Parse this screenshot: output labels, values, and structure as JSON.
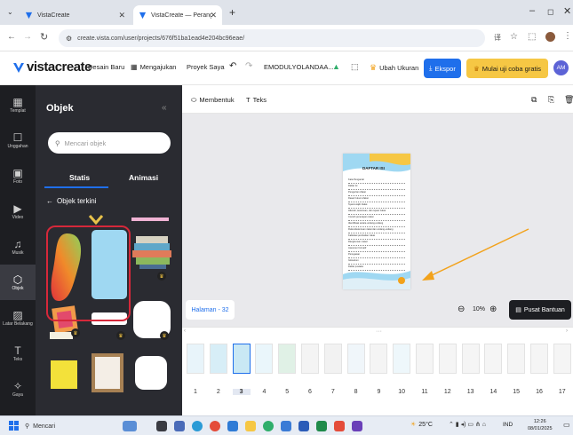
{
  "browser": {
    "tabs": [
      {
        "title": "VistaCreate"
      },
      {
        "title": "VistaCreate — Perangkat Lunak"
      }
    ],
    "url": "create.vista.com/user/projects/676f51ba1ead4e204bc96eae/"
  },
  "app": {
    "logo": "vistacreate",
    "nav": {
      "desain_baru": "Desain Baru",
      "mengajukan": "Mengajukan",
      "proyek_saya": "Proyek Saya",
      "project_name": "EMODULYOLANDAA...",
      "ubah_ukuran": "Ubah Ukuran",
      "ekspor": "Ekspor",
      "trial": "Mulai uji coba gratis",
      "avatar": "AM"
    },
    "toolbar": {
      "membentuk": "Membentuk",
      "teks": "Teks"
    }
  },
  "rail": [
    {
      "label": "Templat",
      "icon": "template-icon"
    },
    {
      "label": "Unggahan",
      "icon": "upload-icon"
    },
    {
      "label": "Foto",
      "icon": "photo-icon"
    },
    {
      "label": "Video",
      "icon": "video-icon"
    },
    {
      "label": "Musik",
      "icon": "music-icon"
    },
    {
      "label": "Objek",
      "icon": "object-icon",
      "active": true
    },
    {
      "label": "Latar Belakang",
      "icon": "background-icon"
    },
    {
      "label": "Teks",
      "icon": "text-icon"
    },
    {
      "label": "Gaya",
      "icon": "style-icon"
    }
  ],
  "panel": {
    "title": "Objek",
    "search_placeholder": "Mencari objek",
    "tabs": [
      "Statis",
      "Animasi"
    ],
    "section": "Objek terkini"
  },
  "document": {
    "heading": "DAFTAR ISI",
    "toc_lines": [
      "Kata Pengantar",
      "Daftar Isi",
      "Pengertian Zakat",
      "Dasar hukum Zakat",
      "Syarat wajib Zakat",
      "Hikmah, ketentuan, dan tujuan zakat",
      "Contoh penerapan zakat",
      "Identifikasi antara undang-undang",
      "Rukun/ketentuan zakat dan undang-undang",
      "Kalkulasi pembelian zakat",
      "Rangkuman materi",
      "Asesmen formatif",
      "Penugasan",
      "Glosarium",
      "Daftar pustaka"
    ]
  },
  "bottom": {
    "page_label": "Halaman - 32",
    "zoom": "10%",
    "help": "Pusat Bantuan",
    "pages": [
      "1",
      "2",
      "3",
      "4",
      "5",
      "6",
      "7",
      "8",
      "9",
      "10",
      "11",
      "12",
      "13",
      "14",
      "15",
      "16",
      "17"
    ],
    "active_page": "3"
  },
  "taskbar": {
    "search": "Mencari",
    "weather": "25°C",
    "lang": "IND",
    "time": "12:26",
    "date": "08/01/2025"
  },
  "colors": {
    "accent_blue": "#1f6feb",
    "trial_yellow": "#f6c744",
    "annotation_red": "#d6283a",
    "arrow_orange": "#f2a21b",
    "dark_panel": "#2a2b31"
  }
}
